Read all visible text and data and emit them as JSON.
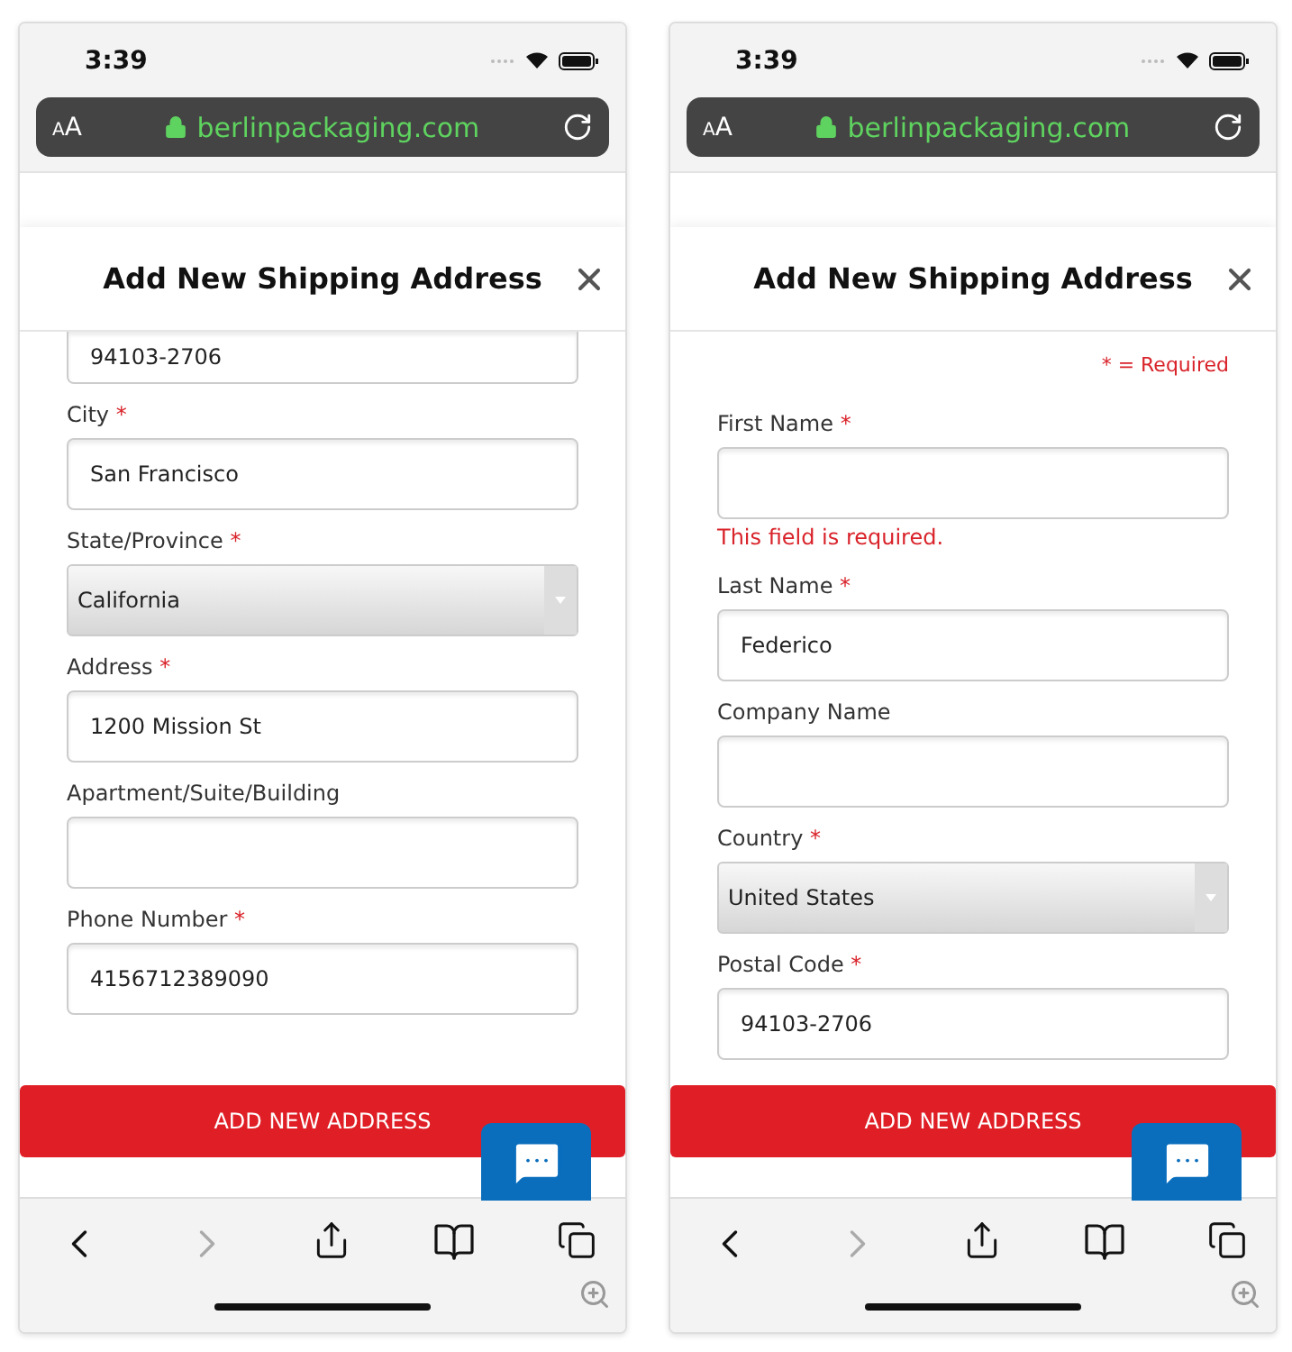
{
  "phones": [
    {
      "status_bar": {
        "time": "3:39"
      },
      "url_bar": {
        "text_size": "AA",
        "url": "berlinpackaging.com"
      },
      "modal": {
        "title": "Add New Shipping Address"
      },
      "fields": [
        {
          "kind": "clipped",
          "value": "94103-2706"
        },
        {
          "kind": "input",
          "label": "City",
          "mark": "*",
          "value": "San Francisco"
        },
        {
          "kind": "select",
          "label": "State/Province",
          "mark": "*",
          "value": "California"
        },
        {
          "kind": "input",
          "label": "Address",
          "mark": "*",
          "value": "1200 Mission St"
        },
        {
          "kind": "input",
          "label": "Apartment/Suite/Building"
        },
        {
          "kind": "input",
          "label": "Phone Number",
          "mark": "*",
          "value": "4156712389090"
        }
      ],
      "button": "ADD NEW ADDRESS",
      "toolbar": {
        "forward_enabled": false
      }
    },
    {
      "status_bar": {
        "time": "3:39"
      },
      "url_bar": {
        "text_size": "AA",
        "url": "berlinpackaging.com"
      },
      "modal": {
        "title": "Add New Shipping Address"
      },
      "required_note": "* = Required",
      "fields": [
        {
          "kind": "input",
          "label": "First Name",
          "mark": "*",
          "error": "This field is required."
        },
        {
          "kind": "input",
          "label": "Last Name",
          "mark": "*",
          "value": "Federico"
        },
        {
          "kind": "input",
          "label": "Company Name"
        },
        {
          "kind": "select",
          "label": "Country",
          "mark": "*",
          "value": "United States"
        },
        {
          "kind": "input",
          "label": "Postal Code",
          "mark": "*",
          "value": "94103-2706"
        }
      ],
      "button": "ADD NEW ADDRESS",
      "toolbar": {
        "forward_enabled": false
      }
    }
  ]
}
